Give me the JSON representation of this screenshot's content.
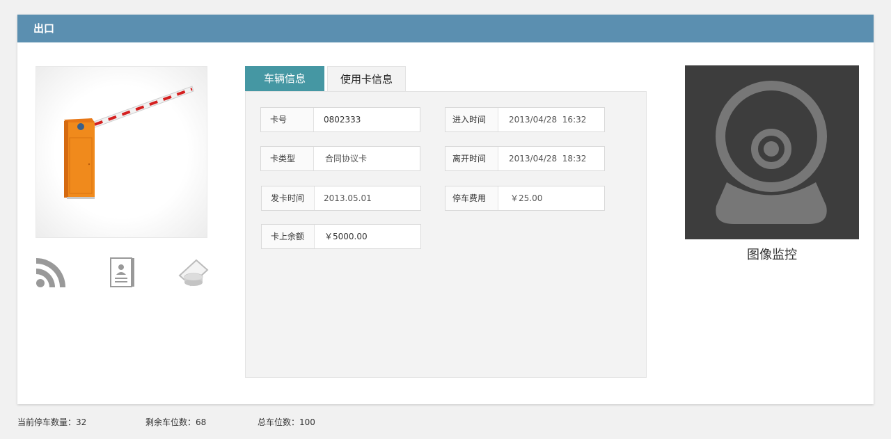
{
  "panel": {
    "title": "出口"
  },
  "tabs": {
    "vehicle_info": "车辆信息",
    "card_info": "使用卡信息"
  },
  "fields": {
    "card_no": {
      "label": "卡号",
      "value": "0802333"
    },
    "card_type": {
      "label": "卡类型",
      "value": "合同协议卡"
    },
    "issue_time": {
      "label": "发卡时间",
      "value": "2013.05.01"
    },
    "balance": {
      "label": "卡上余额",
      "value": "￥5000.00"
    },
    "enter_time": {
      "label": "进入时间",
      "value": "2013/04/28  16:32"
    },
    "leave_time": {
      "label": "离开时间",
      "value": "2013/04/28  18:32"
    },
    "parking_fee": {
      "label": "停车费用",
      "value": "￥25.00"
    }
  },
  "icons": [
    "gate-barrier-icon",
    "rfid-signal-icon",
    "id-card-icon",
    "coin-ticket-icon",
    "camera-icon"
  ],
  "camera": {
    "caption": "图像监控"
  },
  "footer": {
    "current_parked": "当前停车数量：32",
    "remaining_spaces": "剩余车位数：68",
    "total_spaces": "总车位数：100"
  },
  "colors": {
    "header": "#5b8fb0",
    "active_tab": "#4597a3",
    "camera_bg": "#3d3d3d",
    "barrier_orange": "#f08a1c"
  }
}
